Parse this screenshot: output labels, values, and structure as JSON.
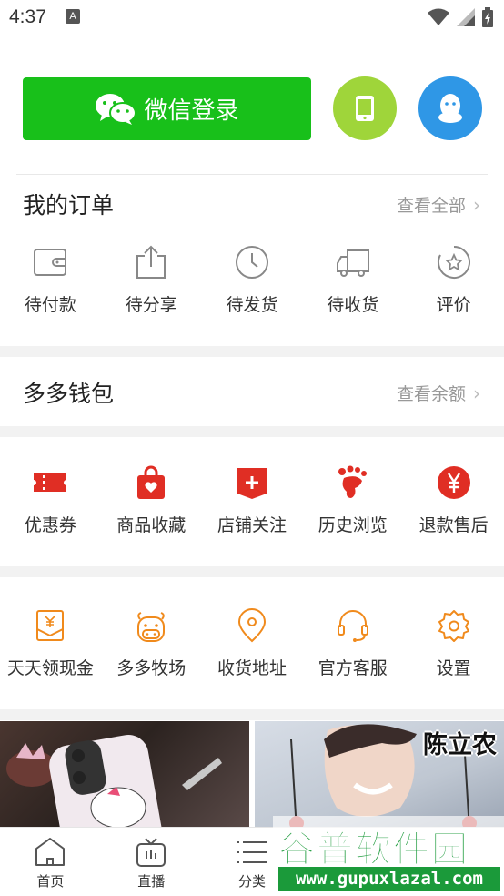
{
  "status_bar": {
    "time": "4:37",
    "notification_letter": "A"
  },
  "login": {
    "wechat_label": "微信登录"
  },
  "orders": {
    "title": "我的订单",
    "view_all": "查看全部",
    "items": [
      {
        "label": "待付款",
        "icon": "wallet-icon"
      },
      {
        "label": "待分享",
        "icon": "share-icon"
      },
      {
        "label": "待发货",
        "icon": "clock-icon"
      },
      {
        "label": "待收货",
        "icon": "truck-icon"
      },
      {
        "label": "评价",
        "icon": "star-badge-icon"
      }
    ]
  },
  "wallet": {
    "title": "多多钱包",
    "view_balance": "查看余额"
  },
  "shortcuts": {
    "accent": "#e02e24",
    "items": [
      {
        "label": "优惠券",
        "icon": "coupon-icon"
      },
      {
        "label": "商品收藏",
        "icon": "bag-heart-icon"
      },
      {
        "label": "店铺关注",
        "icon": "shop-plus-icon"
      },
      {
        "label": "历史浏览",
        "icon": "footprint-icon"
      },
      {
        "label": "退款售后",
        "icon": "yen-circle-icon"
      }
    ]
  },
  "services": {
    "accent": "#f08a1c",
    "items": [
      {
        "label": "天天领现金",
        "icon": "red-envelope-icon"
      },
      {
        "label": "多多牧场",
        "icon": "cow-icon"
      },
      {
        "label": "收货地址",
        "icon": "location-pin-icon"
      },
      {
        "label": "官方客服",
        "icon": "headset-icon"
      },
      {
        "label": "设置",
        "icon": "gear-icon"
      }
    ]
  },
  "banners": {
    "right_caption": "陈立农"
  },
  "tab_bar": {
    "items": [
      {
        "label": "首页",
        "icon": "home-icon"
      },
      {
        "label": "直播",
        "icon": "tv-icon"
      },
      {
        "label": "分类",
        "icon": "list-icon"
      }
    ]
  },
  "watermark": {
    "title": "谷普软件园",
    "url": "www.gupuxlazal.com"
  }
}
